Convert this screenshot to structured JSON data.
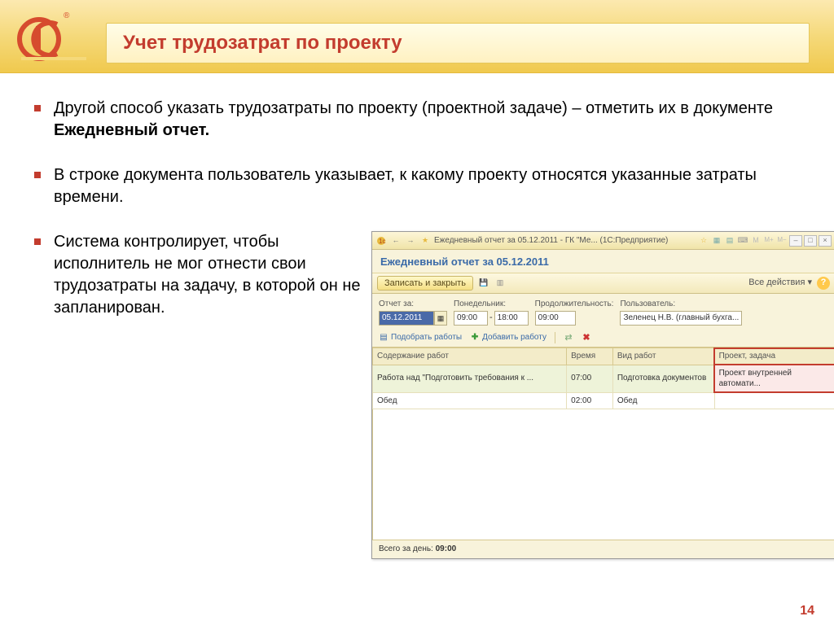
{
  "slide": {
    "title": "Учет трудозатрат по проекту",
    "page": "14"
  },
  "bullets": [
    {
      "pre": "Другой способ указать трудозатраты по проекту (проектной задаче) – отметить их в документе ",
      "bold": "Ежедневный отчет."
    },
    {
      "text": "В строке документа пользователь указывает, к какому проекту относятся указанные затраты времени."
    },
    {
      "text": "Система контролирует, чтобы исполнитель не мог отнести свои трудозатраты на задачу, в которой он не запланирован."
    }
  ],
  "app": {
    "window_title": "Ежедневный отчет за 05.12.2011 - ГК \"Ме...   (1С:Предприятие)",
    "doc_title": "Ежедневный отчет за 05.12.2011",
    "toolbar": {
      "save_close": "Записать и закрыть",
      "all_actions": "Все действия"
    },
    "fields": {
      "date_label": "Отчет за:",
      "date_value": "05.12.2011",
      "weekday_label": "Понедельник:",
      "time_from": "09:00",
      "time_to": "18:00",
      "duration_label": "Продолжительность:",
      "duration_value": "09:00",
      "user_label": "Пользователь:",
      "user_value": "Зеленец Н.В. (главный бухга..."
    },
    "subtoolbar": {
      "pick": "Подобрать работы",
      "add": "Добавить работу"
    },
    "table": {
      "headers": [
        "Содержание работ",
        "Время",
        "Вид работ",
        "Проект, задача"
      ],
      "rows": [
        {
          "content": "Работа над \"Подготовить требования к ...",
          "time": "07:00",
          "kind": "Подготовка документов",
          "project": "Проект внутренней автомати..."
        },
        {
          "content": "Обед",
          "time": "02:00",
          "kind": "Обед",
          "project": ""
        }
      ]
    },
    "status": {
      "total_label": "Всего за день: ",
      "total_value": "09:00"
    }
  }
}
